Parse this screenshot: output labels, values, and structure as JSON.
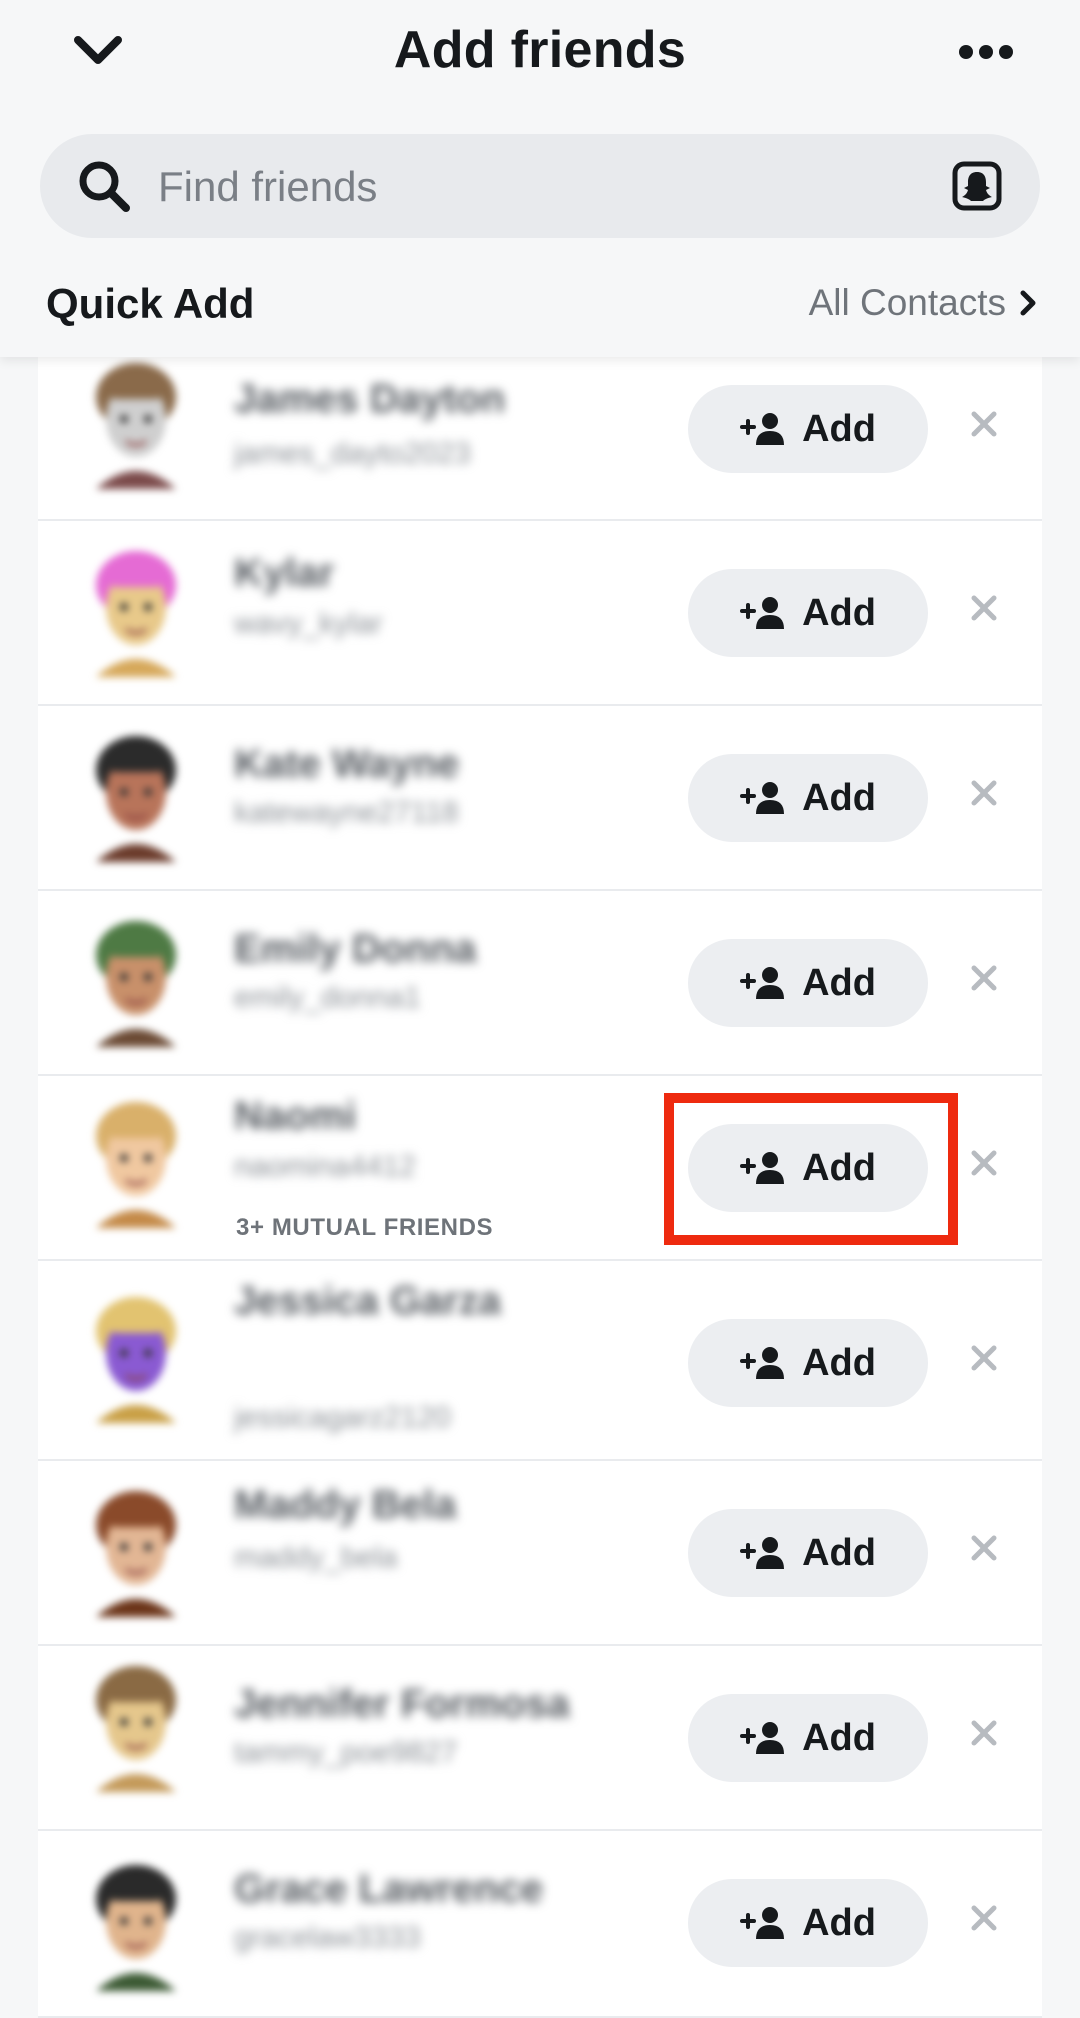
{
  "header": {
    "title": "Add friends",
    "back_icon": "chevron-down-icon",
    "more_icon": "ellipsis-icon"
  },
  "search": {
    "placeholder": "Find friends",
    "value": "",
    "scan_icon": "snapcode-scan-icon"
  },
  "quick_add": {
    "title": "Quick Add",
    "all_contacts_label": "All Contacts"
  },
  "colors": {
    "background": "#f6f7f8",
    "list_background": "#ffffff",
    "button_background": "#eceef1",
    "highlight_border": "#ee2a0f"
  },
  "friends": [
    {
      "name": "James Dayton",
      "username": "james_dayto2023",
      "mutual": "",
      "add_label": "Add",
      "avatar_colors": [
        "#8a6a4a",
        "#cfcfcf",
        "#7b4a4a"
      ]
    },
    {
      "name": "Kylar",
      "username": "wavy_kylar",
      "mutual": "",
      "add_label": "Add",
      "avatar_colors": [
        "#e56bd4",
        "#e8c98a",
        "#d6a85a"
      ]
    },
    {
      "name": "Kate Wayne",
      "username": "katewayne27118",
      "mutual": "",
      "add_label": "Add",
      "avatar_colors": [
        "#2b2b2b",
        "#b8745a",
        "#6b3b2b"
      ]
    },
    {
      "name": "Emily Donna",
      "username": "emily_donna1",
      "mutual": "",
      "add_label": "Add",
      "avatar_colors": [
        "#4e7a44",
        "#c8906a",
        "#6b4a34"
      ]
    },
    {
      "name": "Naomi",
      "username": "naomina4412",
      "mutual": "3+ MUTUAL FRIENDS",
      "add_label": "Add",
      "avatar_colors": [
        "#d9b06a",
        "#f0c8a0",
        "#c48a48"
      ]
    },
    {
      "name": "Jessica Garza",
      "username": "jessicagarz2120",
      "mutual": "",
      "add_label": "Add",
      "avatar_colors": [
        "#e2c370",
        "#8a5ad2",
        "#c9a046"
      ]
    },
    {
      "name": "Maddy Bela",
      "username": "maddy_bela",
      "mutual": "",
      "add_label": "Add",
      "avatar_colors": [
        "#8a4a2a",
        "#e2b694",
        "#6b3418"
      ]
    },
    {
      "name": "Jennifer Formosa",
      "username": "tammy_poe9827",
      "mutual": "",
      "add_label": "Add",
      "avatar_colors": [
        "#8a6a44",
        "#e5c78c",
        "#c49a5a"
      ]
    },
    {
      "name": "Grace Lawrence",
      "username": "gracelaw3333",
      "mutual": "",
      "add_label": "Add",
      "avatar_colors": [
        "#2a2a2a",
        "#e0b48c",
        "#3c5a34"
      ]
    }
  ]
}
